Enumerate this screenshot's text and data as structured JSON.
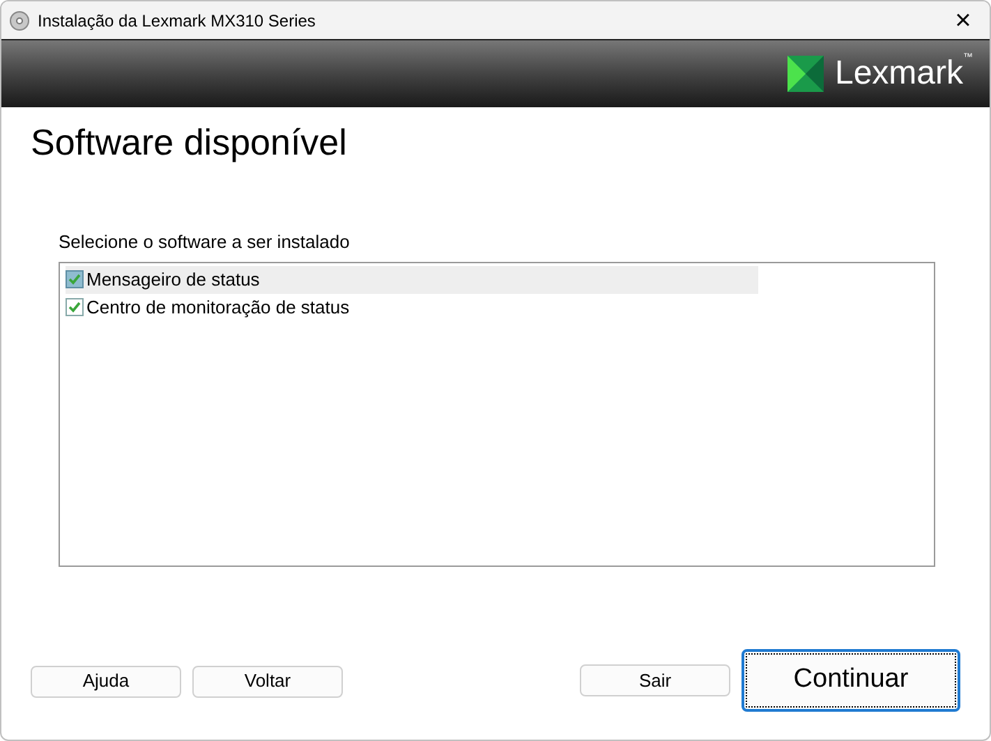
{
  "window": {
    "title": "Instalação da Lexmark MX310 Series",
    "close": "×"
  },
  "banner": {
    "brand": "Lexmark",
    "trademark": "™"
  },
  "heading": "Software disponível",
  "list_label": "Selecione o software a ser instalado",
  "items": [
    {
      "label": "Mensageiro de status",
      "checked": true,
      "selected": true
    },
    {
      "label": "Centro de monitoração de status",
      "checked": true,
      "selected": false
    }
  ],
  "buttons": [
    {
      "label": "Ajuda",
      "kind": "small"
    },
    {
      "label": "Voltar",
      "kind": "small"
    },
    {
      "label": "Sair",
      "kind": "small"
    },
    {
      "label": "Continuar",
      "kind": "default"
    }
  ]
}
